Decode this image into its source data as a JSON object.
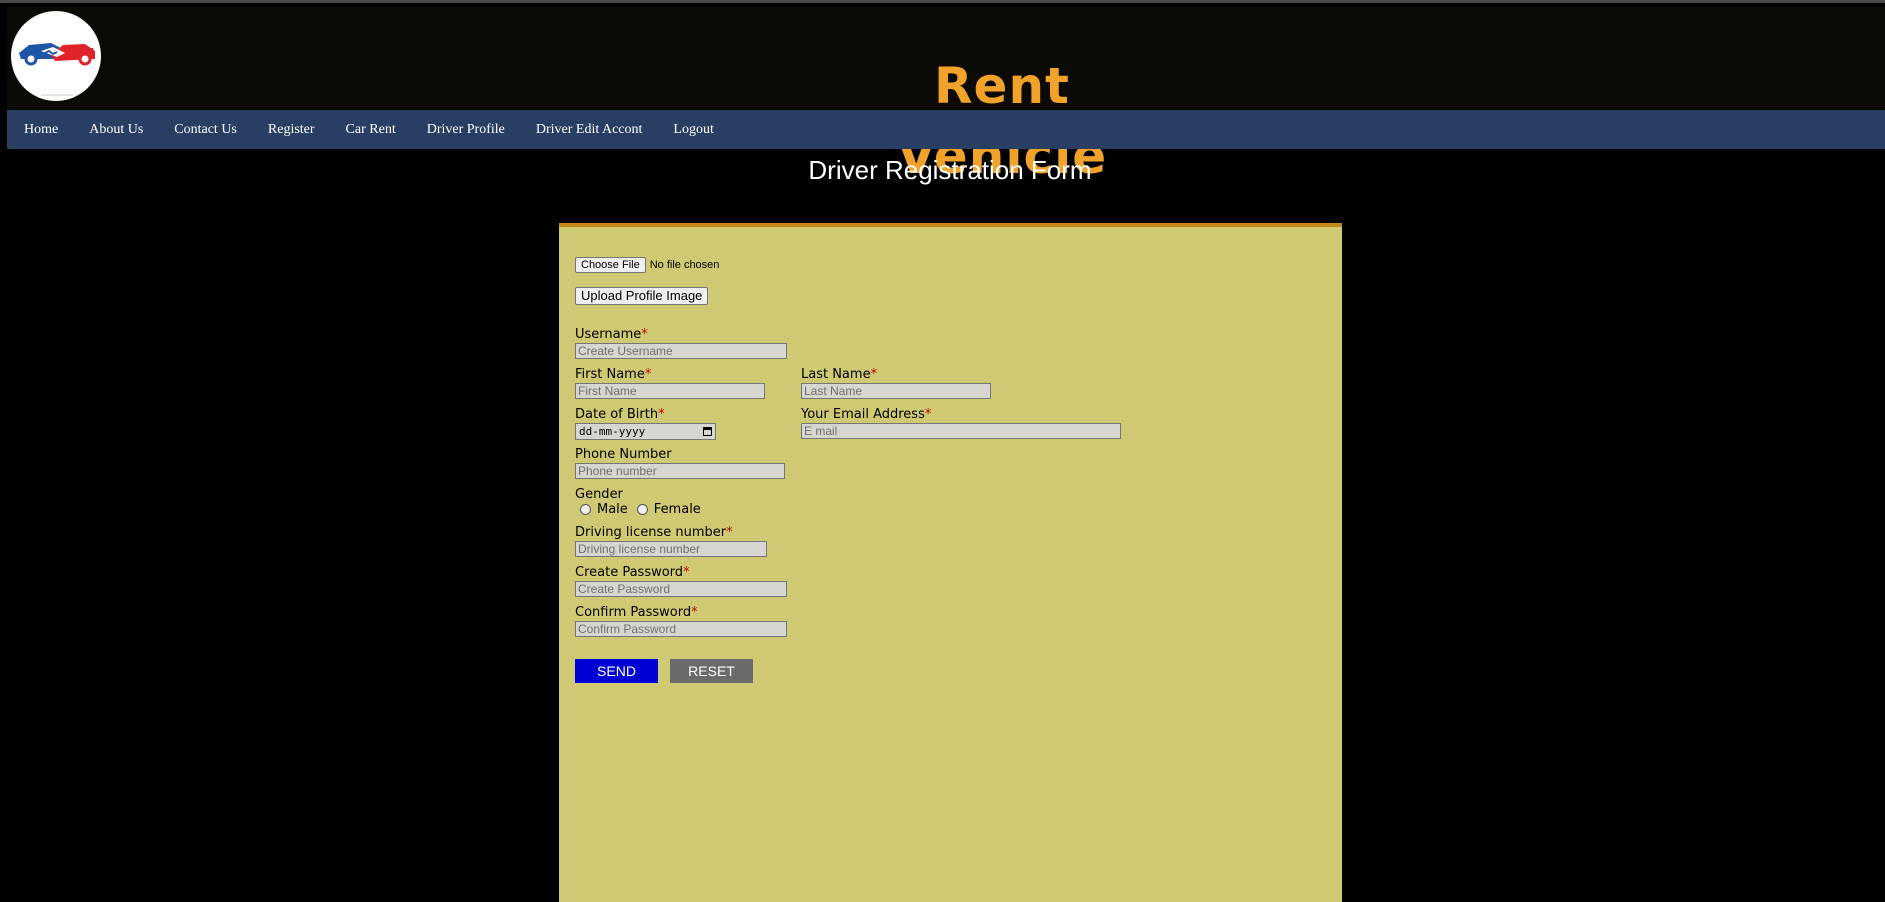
{
  "header": {
    "brand": "Rent Vehicle",
    "logo_icon": "car-handshake-logo"
  },
  "nav": {
    "items": [
      {
        "label": "Home"
      },
      {
        "label": "About Us"
      },
      {
        "label": "Contact Us"
      },
      {
        "label": "Register"
      },
      {
        "label": "Car Rent"
      },
      {
        "label": "Driver Profile"
      },
      {
        "label": "Driver Edit Accont"
      },
      {
        "label": "Logout"
      }
    ]
  },
  "page": {
    "title": "Driver Registration Form"
  },
  "form": {
    "file": {
      "button": "Choose File",
      "status": "No file chosen"
    },
    "upload_button": "Upload Profile Image",
    "required_mark": "*",
    "username": {
      "label": "Username",
      "placeholder": "Create Username"
    },
    "first_name": {
      "label": "First Name",
      "placeholder": "First Name"
    },
    "last_name": {
      "label": "Last Name",
      "placeholder": "Last Name"
    },
    "dob": {
      "label": "Date of Birth",
      "value": "dd-mm-yyyy"
    },
    "email": {
      "label": "Your Email Address",
      "placeholder": "E mail"
    },
    "phone": {
      "label": "Phone Number",
      "placeholder": "Phone number"
    },
    "gender": {
      "label": "Gender",
      "options": [
        "Male",
        "Female"
      ]
    },
    "license": {
      "label": "Driving license number",
      "placeholder": "Driving license number"
    },
    "password": {
      "label": "Create Password",
      "placeholder": "Create Password"
    },
    "confirm": {
      "label": "Confirm Password",
      "placeholder": "Confirm Password"
    },
    "send_button": "SEND",
    "reset_button": "RESET"
  },
  "colors": {
    "brand": "#f0a22a",
    "nav_bg": "#283e63",
    "panel_bg": "#cfc974",
    "panel_border": "#c2891a",
    "send": "#0000d4",
    "reset": "#6b6b6b",
    "required": "#c40000"
  }
}
